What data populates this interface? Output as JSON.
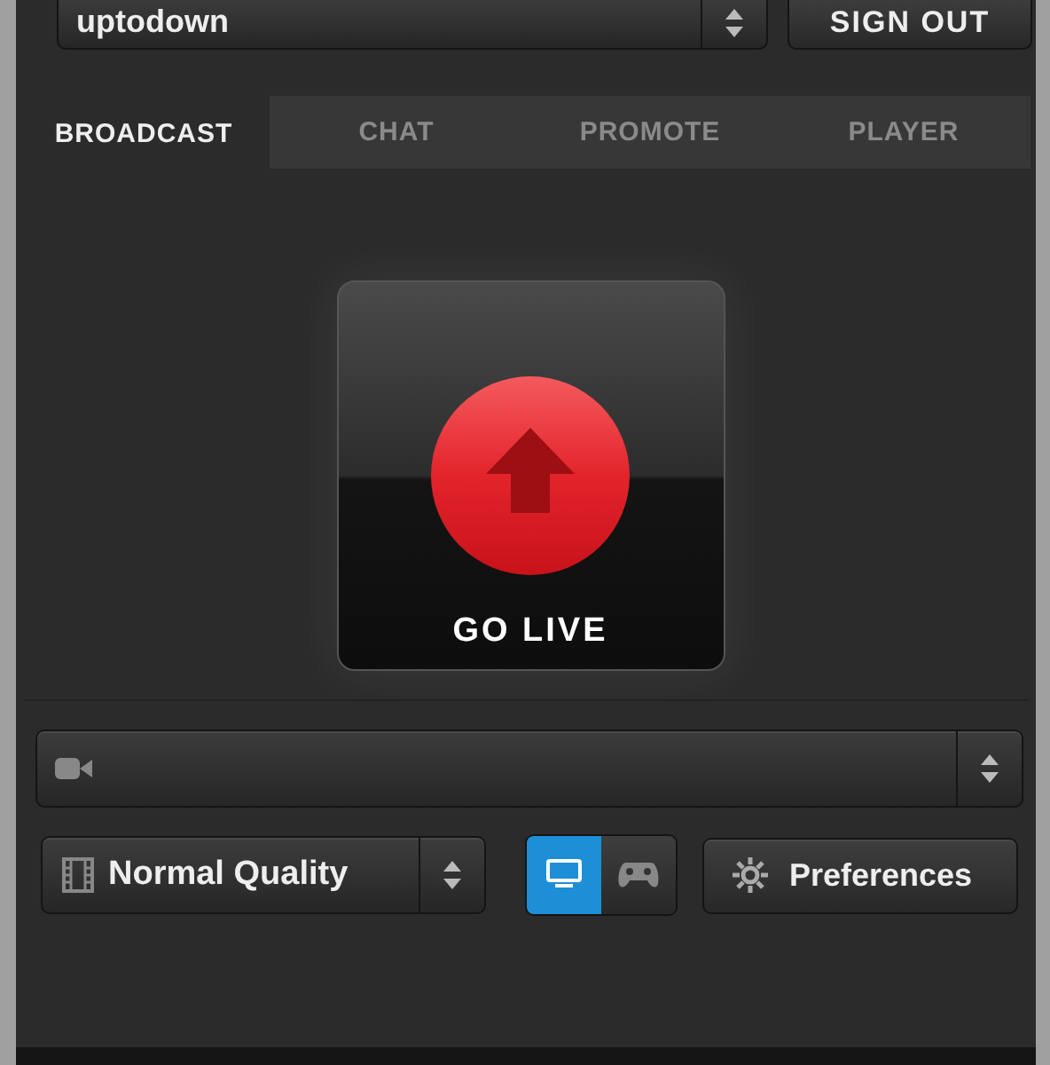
{
  "account": {
    "value": "uptodown"
  },
  "sign_out": "SIGN OUT",
  "tabs": [
    {
      "label": "BROADCAST",
      "selected": true
    },
    {
      "label": "CHAT",
      "selected": false
    },
    {
      "label": "PROMOTE",
      "selected": false
    },
    {
      "label": "PLAYER",
      "selected": false
    }
  ],
  "go_live": "GO LIVE",
  "quality": {
    "value": "Normal Quality"
  },
  "modes": [
    {
      "kind": "screen",
      "selected": true
    },
    {
      "kind": "game",
      "selected": false
    }
  ],
  "preferences": "Preferences"
}
